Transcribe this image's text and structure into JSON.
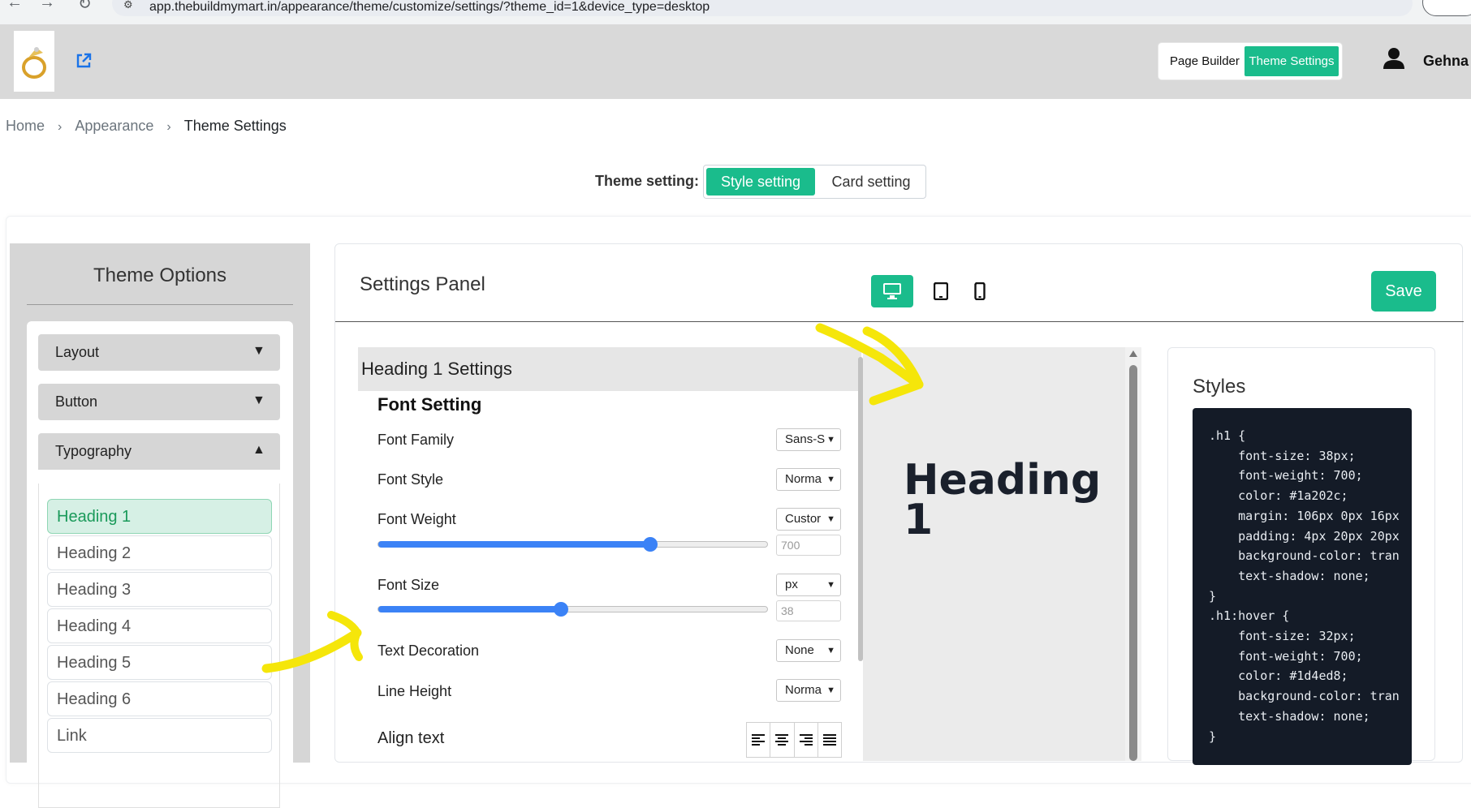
{
  "browser": {
    "url": "app.thebuildmymart.in/appearance/theme/customize/settings/?theme_id=1&device_type=desktop"
  },
  "header": {
    "mode_page_builder": "Page Builder",
    "mode_theme_settings": "Theme Settings",
    "user_name": "Gehna"
  },
  "breadcrumb": {
    "items": [
      "Home",
      "Appearance",
      "Theme Settings"
    ]
  },
  "theme_setting": {
    "label": "Theme setting:",
    "options": [
      "Style setting",
      "Card setting"
    ],
    "selected": "Style setting"
  },
  "sidebar": {
    "title": "Theme Options",
    "sections": [
      {
        "label": "Layout",
        "expanded": false
      },
      {
        "label": "Button",
        "expanded": false
      },
      {
        "label": "Typography",
        "expanded": true
      }
    ],
    "typography_items": [
      "Heading 1",
      "Heading 2",
      "Heading 3",
      "Heading 4",
      "Heading 5",
      "Heading 6",
      "Link"
    ],
    "active_item": "Heading 1"
  },
  "panel": {
    "title": "Settings Panel",
    "save_label": "Save",
    "device": "desktop",
    "devices": [
      "desktop-icon",
      "tablet-icon",
      "mobile-icon"
    ]
  },
  "heading_settings": {
    "title": "Heading 1 Settings",
    "section_title": "Font Setting",
    "font_family": {
      "label": "Font Family",
      "value": "Sans-S"
    },
    "font_style": {
      "label": "Font Style",
      "value": "Norma"
    },
    "font_weight": {
      "label": "Font Weight",
      "value": "Custor",
      "number": "700",
      "slider_fraction": 0.7
    },
    "font_size": {
      "label": "Font Size",
      "value": "px",
      "number": "38",
      "slider_fraction": 0.47
    },
    "text_decoration": {
      "label": "Text Decoration",
      "value": "None"
    },
    "line_height": {
      "label": "Line Height",
      "value": "Norma"
    },
    "align_text": {
      "label": "Align text"
    }
  },
  "preview": {
    "heading_text": "Heading 1",
    "color": "#1a202c"
  },
  "styles": {
    "title": "Styles",
    "code": ".h1 {\n    font-size: 38px;\n    font-weight: 700;\n    color: #1a202c;\n    margin: 106px 0px 16px\n    padding: 4px 20px 20px\n    background-color: tran\n    text-shadow: none;\n}\n.h1:hover {\n    font-size: 32px;\n    font-weight: 700;\n    color: #1d4ed8;\n    background-color: tran\n    text-shadow: none;\n}"
  },
  "colors": {
    "accent": "#1abc8c",
    "slider": "#3b82f6",
    "annotation": "#f5e60a"
  }
}
